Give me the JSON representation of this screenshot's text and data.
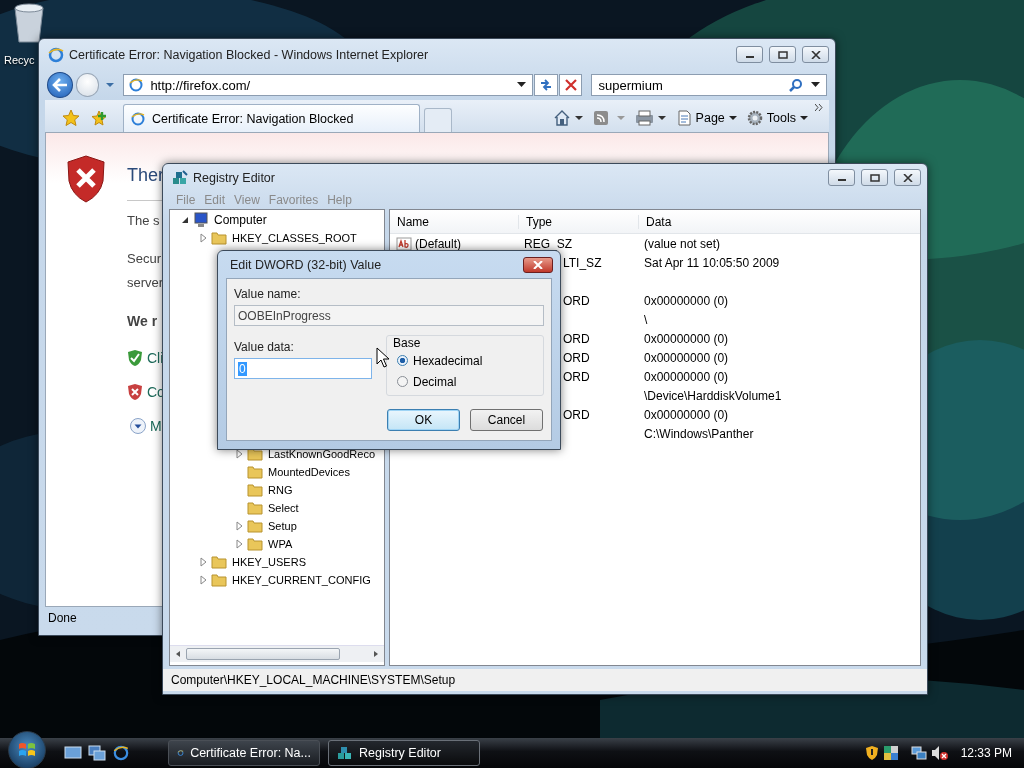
{
  "desktop": {
    "icons": [
      {
        "label": "Recyc"
      }
    ]
  },
  "browser": {
    "title": "Certificate Error: Navigation Blocked - Windows Internet Explorer",
    "address": "http://firefox.com/",
    "search": "supermium",
    "tabs": [
      {
        "label": "Certificate Error: Navigation Blocked",
        "selected": true
      }
    ],
    "commands": [
      {
        "kind": "page",
        "label": "Page"
      },
      {
        "kind": "tools",
        "label": "Tools"
      }
    ],
    "page": {
      "heading": "Ther",
      "paragraphs": [
        {
          "lines": [
            "The s"
          ]
        },
        {
          "lines": [
            "Secur",
            "server"
          ]
        }
      ],
      "recommend": "We r",
      "options": [
        {
          "kind": "ok",
          "label": "Cli"
        },
        {
          "kind": "bad",
          "label": "Co"
        },
        {
          "kind": "more",
          "label": "M"
        }
      ]
    },
    "status": "Done"
  },
  "regedit": {
    "title": "Registry Editor",
    "menu": [
      "File",
      "Edit",
      "View",
      "Favorites",
      "Help"
    ],
    "tree": {
      "label": "Computer",
      "expanded": true,
      "children": [
        {
          "label": "HKEY_CLASSES_ROOT",
          "expanded": false
        },
        {
          "label": "HKEY_USERS",
          "expanded": false
        },
        {
          "label": "HKEY_CURRENT_CONFIG",
          "expanded": false
        }
      ]
    },
    "subkeys_in_view": [
      {
        "label": "LastKnownGoodReco",
        "has_children": true
      },
      {
        "label": "MountedDevices",
        "has_children": false
      },
      {
        "label": "RNG",
        "has_children": false
      },
      {
        "label": "Select",
        "has_children": false
      },
      {
        "label": "Setup",
        "has_children": true
      },
      {
        "label": "WPA",
        "has_children": true
      }
    ],
    "columns": [
      "Name",
      "Type",
      "Data"
    ],
    "values": [
      {
        "name": "(Default)",
        "type": "REG_SZ",
        "data": "(value not set)"
      },
      {
        "type": "LTI_SZ",
        "data": "Sat Apr 11 10:05:50 2009"
      },
      {
        "type": "ORD",
        "data": "0x00000000 (0)"
      },
      {
        "data": "\\"
      },
      {
        "type": "ORD",
        "data": "0x00000000 (0)"
      },
      {
        "type": "ORD",
        "data": "0x00000000 (0)"
      },
      {
        "type": "ORD",
        "data": "0x00000000 (0)"
      },
      {
        "data": "\\Device\\HarddiskVolume1"
      },
      {
        "type": "ORD",
        "data": "0x00000000 (0)"
      },
      {
        "data": "C:\\Windows\\Panther"
      }
    ],
    "status": "Computer\\HKEY_LOCAL_MACHINE\\SYSTEM\\Setup"
  },
  "dialog": {
    "title": "Edit DWORD (32-bit) Value",
    "value_name_label": "Value name:",
    "value_name": "OOBEInProgress",
    "value_data_label": "Value data:",
    "value_data": "0",
    "base_label": "Base",
    "bases": [
      {
        "label": "Hexadecimal",
        "selected": true
      },
      {
        "label": "Decimal",
        "selected": false
      }
    ],
    "buttons": [
      {
        "label": "OK",
        "default": true
      },
      {
        "label": "Cancel",
        "default": false
      }
    ]
  },
  "taskbar": {
    "tasks": [
      {
        "kind": "ie",
        "label": "Certificate Error: Na...",
        "selected": false
      },
      {
        "kind": "regedit",
        "label": "Registry Editor",
        "selected": true
      }
    ],
    "clock": "12:33 PM"
  }
}
